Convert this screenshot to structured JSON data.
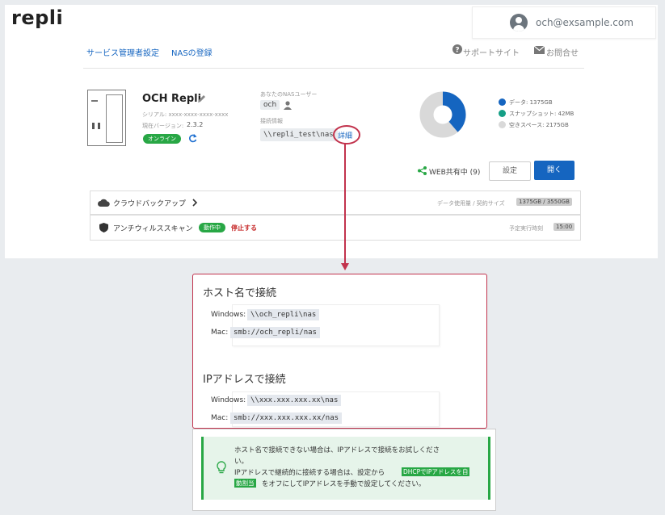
{
  "brand": {
    "logo": "repli"
  },
  "user": {
    "email": "och@exsample.com"
  },
  "nav": {
    "service_admin": "サービス管理者設定",
    "nas_register": "NASの登録",
    "support_site": "サポートサイト",
    "contact": "お問合せ"
  },
  "device": {
    "name": "OCH Repli",
    "serial": "シリアル: xxxx-xxxx-xxxx-xxxx",
    "version_label": "現在バージョン:",
    "version": "2.3.2",
    "status": "オンライン"
  },
  "nas": {
    "user_label": "あなたのNASユーザー",
    "user": "och",
    "conn_label": "接続情報",
    "conn_path": "\\\\repli_test\\nas",
    "detail_link": "詳細"
  },
  "storage": {
    "legend": [
      {
        "label": "データ: 1375GB",
        "color": "#1565c0"
      },
      {
        "label": "スナップショット: 42MB",
        "color": "#159f86"
      },
      {
        "label": "空きスペース: 2175GB",
        "color": "#d9d9d9"
      }
    ],
    "used_fraction": 0.387
  },
  "actions": {
    "web_share": "WEB共有中 (9)",
    "settings": "設定",
    "open": "開く"
  },
  "cloud_backup": {
    "label": "クラウドバックアップ",
    "usage_label": "データ使用量 / 契約サイズ",
    "usage": "1375GB / 3550GB"
  },
  "antivirus": {
    "label": "アンチウィルススキャン",
    "status": "動作中",
    "stop": "停止する",
    "schedule_label": "予定実行時刻",
    "schedule": "15:00"
  },
  "connect_detail": {
    "host_title": "ホスト名で接続",
    "host_windows_label": "Windows:",
    "host_windows": "\\\\och_repli\\nas",
    "host_mac_label": "Mac:",
    "host_mac": "smb://och_repli/nas",
    "ip_title": "IPアドレスで接続",
    "ip_windows_label": "Windows:",
    "ip_windows": "\\\\xxx.xxx.xxx.xx\\nas",
    "ip_mac_label": "Mac:",
    "ip_mac": "smb://xxx.xxx.xxx.xx/nas"
  },
  "notice": {
    "line1": "ホスト名で接続できない場合は、IPアドレスで接続をお試しくださ",
    "line2": "い。",
    "line3": "IPアドレスで継続的に接続する場合は、設定から",
    "highlight1": "DHCPでIPアドレスを自",
    "highlight2": "動割当",
    "line4": "をオフにしてIPアドレスを手動で設定してください。"
  },
  "colors": {
    "accent": "#1565c0",
    "success": "#28a745",
    "danger": "#c2334d"
  }
}
